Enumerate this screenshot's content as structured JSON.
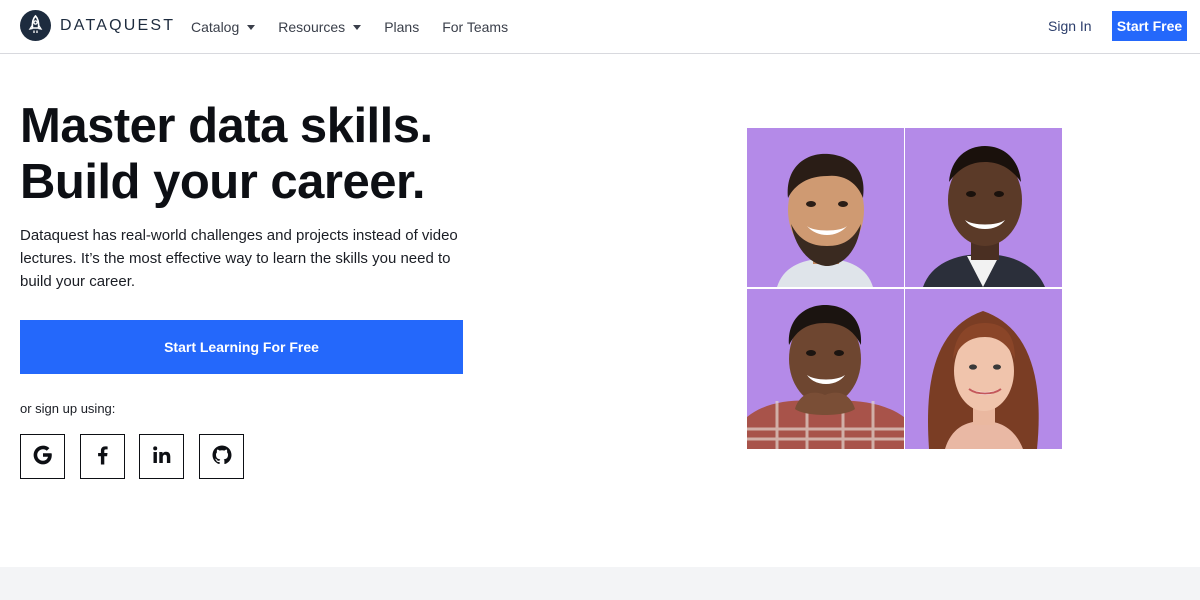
{
  "header": {
    "logo_text": "DATAQUEST",
    "nav": [
      {
        "label": "Catalog",
        "has_dropdown": true
      },
      {
        "label": "Resources",
        "has_dropdown": true
      },
      {
        "label": "Plans",
        "has_dropdown": false
      },
      {
        "label": "For Teams",
        "has_dropdown": false
      }
    ],
    "sign_in_label": "Sign In",
    "start_free_label": "Start Free"
  },
  "hero": {
    "headline_line1": "Master data skills.",
    "headline_line2": "Build your career.",
    "description": "Dataquest has real-world challenges and projects instead of video lectures. It’s the most effective way to learn the skills you need to build your career.",
    "cta_label": "Start Learning For Free",
    "signup_label": "or sign up using:",
    "social": [
      {
        "icon": "google-icon",
        "glyph": "G"
      },
      {
        "icon": "facebook-icon",
        "glyph": "f"
      },
      {
        "icon": "linkedin-icon",
        "glyph": "in"
      },
      {
        "icon": "github-icon",
        "glyph": "github"
      }
    ]
  },
  "photos": [
    {
      "icon": "person-photo-1"
    },
    {
      "icon": "person-photo-2"
    },
    {
      "icon": "person-photo-3"
    },
    {
      "icon": "person-photo-4"
    }
  ],
  "colors": {
    "accent": "#2468fb",
    "logo": "#1d2b3e",
    "photo_bg": "#b48ae8",
    "footer_band": "#f3f4f6"
  }
}
